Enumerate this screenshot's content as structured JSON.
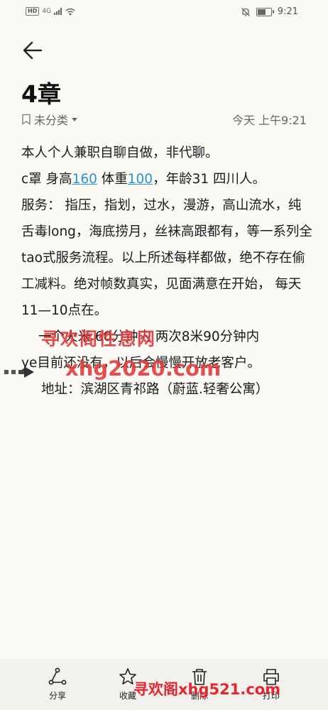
{
  "status_bar": {
    "left_badge": "HD",
    "network": "4G",
    "time": "9:21",
    "battery_level": 0.55
  },
  "note": {
    "title": "4章",
    "category": "未分类",
    "datetime": "今天 上午9:21",
    "line1": "本人个人兼职自聊自做，非代聊。",
    "line2_a": "c罩 身高",
    "height_link": "160",
    "line2_b": " 体重",
    "weight_link": "100",
    "line2_c": "，年龄31 四川人。",
    "paragraph": "服务：  指压，指划，过水，漫游，高山流水，纯舌毒long，海底捞月，丝袜高跟都有，等一系列全tao式服务流程。以上所述每样都做，绝不存在偷工减料。绝对帧数真实，见面满意在开始， 每天11—10点在。",
    "line_price": "一个火米 60分钟内  两次8米90分钟内",
    "line_new": "ye目前还没有，以后会慢慢开放老客户。",
    "line_address": "地址：滨湖区青祁路（蔚蓝.轻奢公寓）"
  },
  "watermarks": {
    "top": "寻欢阁性息网",
    "middle": "xhg2020.com",
    "bottom": "寻欢阁xhg521.com"
  },
  "bottom_bar": {
    "share": "分享",
    "favorite": "收藏",
    "delete": "删除",
    "print": "打印"
  }
}
